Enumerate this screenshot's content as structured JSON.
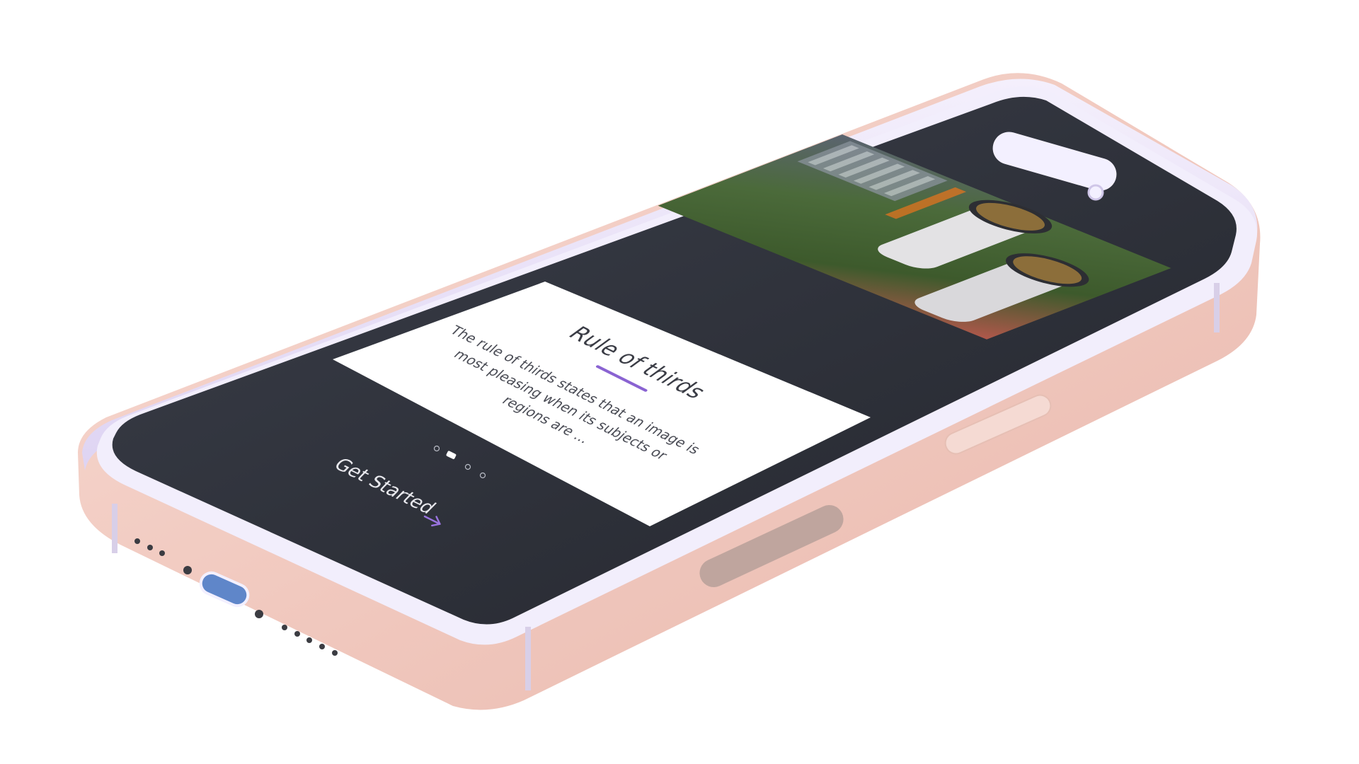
{
  "device": {
    "frame_color": "#f3cfc6",
    "rail_color": "#eae2ff",
    "screen_color": "#2b2e38"
  },
  "onboarding": {
    "card": {
      "title": "Rule of thirds",
      "body_lines": [
        "The rule of thirds states that an image is",
        "most pleasing when its subjects or",
        "regions are ..."
      ],
      "accent_color": "#8a63d2",
      "image_icon": "sneakers-photo"
    },
    "pagination": {
      "total": 4,
      "active_index": 1
    },
    "cta": {
      "label": "Get Started",
      "icon": "arrow-right-icon"
    }
  }
}
